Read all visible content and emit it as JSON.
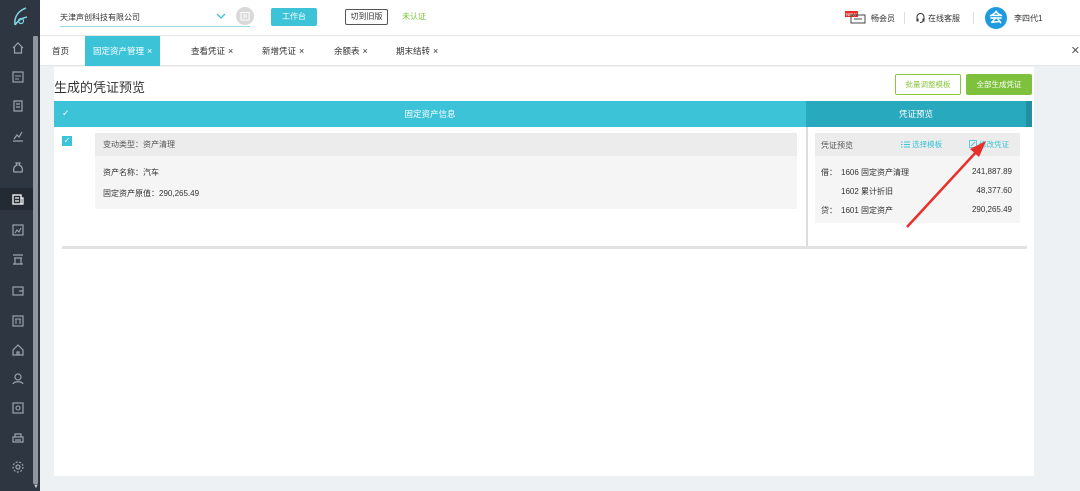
{
  "topbar": {
    "company": "天津声创科技有限公司",
    "workbench_label": "工作台",
    "old_version_label": "切到旧版",
    "unverified_label": "未认证",
    "vip_badge": "NEW",
    "vip_label": "畅会员",
    "service_label": "在线客服",
    "avatar_text": "会",
    "username": "李四代1"
  },
  "tabs": [
    {
      "label": "首页",
      "closable": false,
      "active": false
    },
    {
      "label": "固定资产管理",
      "closable": true,
      "active": true
    },
    {
      "label": "查看凭证",
      "closable": true,
      "active": false
    },
    {
      "label": "新增凭证",
      "closable": true,
      "active": false
    },
    {
      "label": "余额表",
      "closable": true,
      "active": false
    },
    {
      "label": "期末结转",
      "closable": true,
      "active": false
    }
  ],
  "tab_close_glyph": "×",
  "close_all_glyph": "✕",
  "page": {
    "title": "生成的凭证预览",
    "batch_button": "批量调整模板",
    "generate_all_button": "全部生成凭证"
  },
  "table": {
    "check_glyph": "✓",
    "asset_header": "固定资产信息",
    "voucher_header": "凭证预览"
  },
  "asset": {
    "change_type": "变动类型：资产清理",
    "name": "资产名称：汽车",
    "original_value": "固定资产原值：290,265.49"
  },
  "voucher": {
    "title": "凭证预览",
    "select_template": "选择模板",
    "edit_voucher": "修改凭证",
    "lines": [
      {
        "direction": "借：",
        "account": "1606 固定资产清理",
        "amount": "241,887.89"
      },
      {
        "direction": "",
        "account": "1602 累计折旧",
        "amount": "48,377.60"
      },
      {
        "direction": "贷：",
        "account": "1601 固定资产",
        "amount": "290,265.49"
      }
    ]
  },
  "colors": {
    "accent": "#3cc3d8",
    "green": "#7ec13d",
    "sidebar": "#2e3641",
    "arrow": "#e8302a"
  },
  "sidebar_icons": [
    "home-icon",
    "voucher-icon",
    "document-icon",
    "chart-icon",
    "money-bag-icon",
    "asset-icon",
    "report-icon",
    "tax-icon",
    "wallet-icon",
    "invoice-icon",
    "house-icon",
    "user-icon",
    "archive-icon",
    "print-icon",
    "settings-icon"
  ]
}
